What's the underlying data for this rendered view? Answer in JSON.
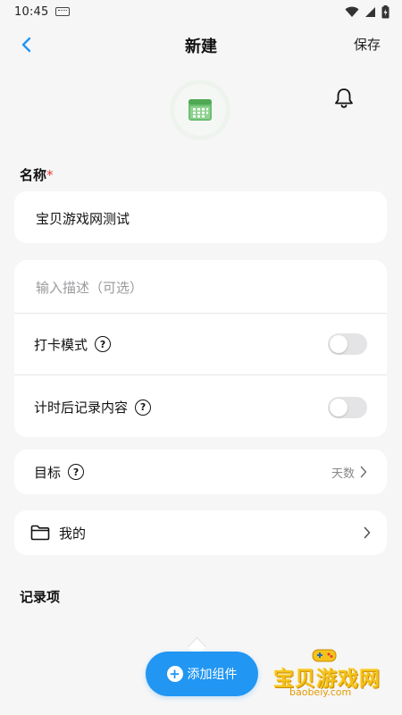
{
  "status_bar": {
    "time": "10:45"
  },
  "header": {
    "title": "新建",
    "save_label": "保存"
  },
  "form": {
    "name_label": "名称",
    "required_mark": "*",
    "name_value": "宝贝游戏网测试",
    "description_placeholder": "输入描述（可选）",
    "checkin_mode_label": "打卡模式",
    "checkin_mode_on": false,
    "record_after_timer_label": "计时后记录内容",
    "record_after_timer_on": false,
    "goal_label": "目标",
    "goal_value": "天数",
    "folder_label": "我的",
    "records_title": "记录项"
  },
  "bottom": {
    "add_component_label": "添加组件"
  },
  "watermark": {
    "main": "宝贝游戏网",
    "sub": "baobeiy.com"
  },
  "colors": {
    "accent": "#2196f3",
    "icon_green": "#66bb6a",
    "required": "#e53935"
  },
  "icons": {
    "back": "chevron-left-icon",
    "calendar": "calendar-icon",
    "bell": "bell-icon",
    "help": "question-circle-icon",
    "folder": "folder-icon",
    "chevron": "chevron-right-icon",
    "plus": "plus-circle-icon"
  }
}
